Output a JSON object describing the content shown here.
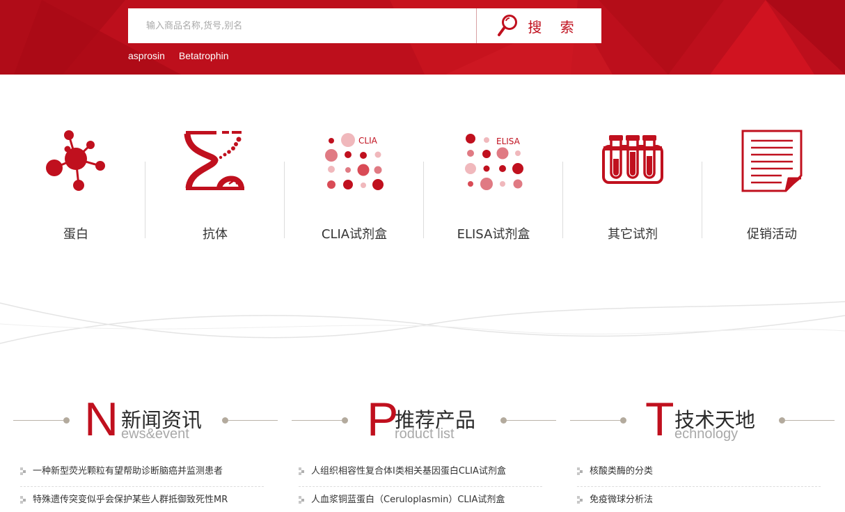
{
  "search": {
    "placeholder": "输入商品名称,货号,别名",
    "button_label": "搜 索",
    "hot_words": [
      "asprosin",
      "Betatrophin"
    ]
  },
  "categories": [
    {
      "label": "蛋白",
      "icon": "protein-molecule-icon"
    },
    {
      "label": "抗体",
      "icon": "hourglass-dna-icon"
    },
    {
      "label": "CLIA试剂盒",
      "icon": "clia-dots-icon",
      "icon_text": "CLIA"
    },
    {
      "label": "ELISA试剂盒",
      "icon": "elisa-dots-icon",
      "icon_text": "ELISA"
    },
    {
      "label": "其它试剂",
      "icon": "test-tubes-icon"
    },
    {
      "label": "促销活动",
      "icon": "document-icon"
    }
  ],
  "sections": [
    {
      "letter": "N",
      "title": "新闻资讯",
      "subtitle": "ews&event",
      "items": [
        "一种新型荧光颗粒有望帮助诊断脑癌并监测患者",
        "特殊遗传突变似乎会保护某些人群抵御致死性MR"
      ]
    },
    {
      "letter": "P",
      "title": "推荐产品",
      "subtitle": "roduct list",
      "items": [
        "人组织相容性复合体Ⅰ类相关基因蛋白CLIA试剂盒",
        "人血浆铜蓝蛋白（Ceruloplasmin）CLIA试剂盒"
      ]
    },
    {
      "letter": "T",
      "title": "技术天地",
      "subtitle": "echnology",
      "items": [
        "核酸类酶的分类",
        "免疫微球分析法"
      ]
    }
  ],
  "colors": {
    "brand_red": "#c0101e",
    "line_gray": "#b9b2a8"
  }
}
